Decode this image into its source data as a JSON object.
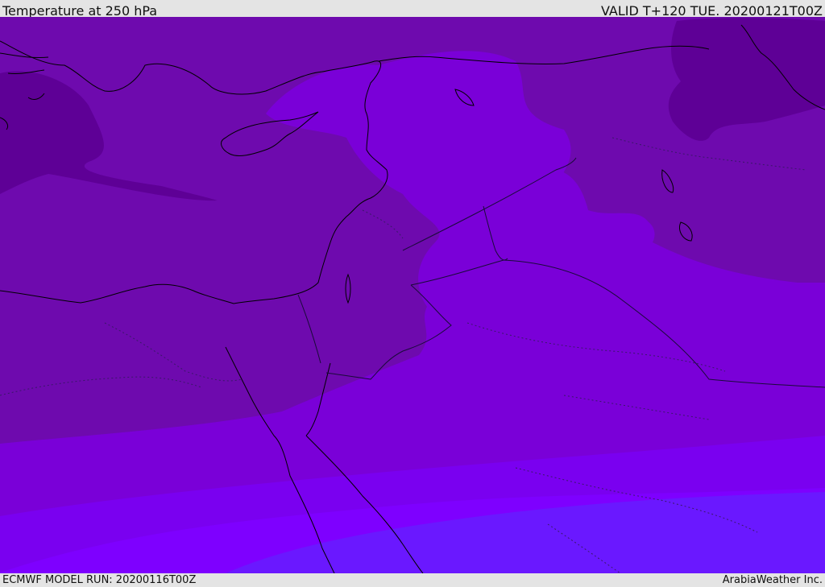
{
  "header": {
    "title": "Temperature at 250 hPa",
    "valid": "VALID T+120 TUE. 20200121T00Z"
  },
  "footer": {
    "model_run": "ECMWF MODEL RUN: 20200116T00Z",
    "credit": "ArabiaWeather Inc."
  },
  "colors": {
    "band_coldest": "#5e0096",
    "band_cold": "#6e0aae",
    "band_mid": "#7a00d8",
    "band_warm": "#7a00f0",
    "band_warmer": "#7e00ff",
    "band_warmest": "#6a18ff",
    "coastline": "#000000",
    "border": "#1a0a3a"
  }
}
